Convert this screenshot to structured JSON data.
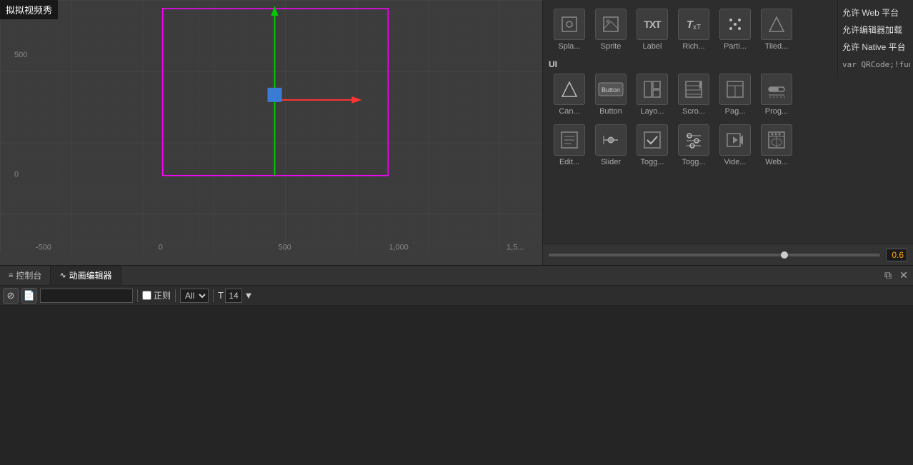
{
  "watermark": {
    "text": "拟拟视频秀"
  },
  "right_panel": {
    "ui_label": "UI",
    "components_row1": [
      {
        "id": "canvas",
        "label": "Can...",
        "icon": "△"
      },
      {
        "id": "button",
        "label": "Button",
        "icon": "▭"
      },
      {
        "id": "layout",
        "label": "Layo...",
        "icon": "⊞"
      },
      {
        "id": "scroll",
        "label": "Scro...",
        "icon": "▤"
      },
      {
        "id": "page",
        "label": "Pag...",
        "icon": "📄"
      },
      {
        "id": "progress",
        "label": "Prog...",
        "icon": "▬"
      }
    ],
    "components_row2": [
      {
        "id": "editbox",
        "label": "Edit...",
        "icon": "▭"
      },
      {
        "id": "slider",
        "label": "Slider",
        "icon": "⊕"
      },
      {
        "id": "toggle1",
        "label": "Togg...",
        "icon": "☑"
      },
      {
        "id": "toggle2",
        "label": "Togg...",
        "icon": "☰"
      },
      {
        "id": "video",
        "label": "Vide...",
        "icon": "▷"
      },
      {
        "id": "web",
        "label": "Web...",
        "icon": "🌐"
      }
    ],
    "top_row": [
      {
        "id": "splash",
        "label": "Spla...",
        "icon": "⊡"
      },
      {
        "id": "sprite",
        "label": "Sprite",
        "icon": "⊡"
      },
      {
        "id": "label",
        "label": "Label",
        "icon": "TXT"
      },
      {
        "id": "richtext",
        "label": "Rich...",
        "icon": "TxT"
      },
      {
        "id": "particle",
        "label": "Parti...",
        "icon": "⁘"
      },
      {
        "id": "tiled",
        "label": "Tiled...",
        "icon": "◇"
      }
    ],
    "slider_value": "0.6",
    "right_text": [
      {
        "text": "允许 Web 平台"
      },
      {
        "text": "允许编辑器加载"
      },
      {
        "text": "允许 Native 平台"
      }
    ],
    "code_text": "var QRCode;!fun"
  },
  "bottom_panel": {
    "tabs": [
      {
        "id": "console",
        "label": "控制台",
        "icon": "≡",
        "active": false
      },
      {
        "id": "animation",
        "label": "动画编辑器",
        "icon": "~",
        "active": true
      }
    ],
    "toolbar": {
      "stop_label": "⊘",
      "file_label": "📄",
      "search_placeholder": "",
      "regex_label": "正则",
      "all_label": "All",
      "font_icon": "T",
      "font_size": "14"
    }
  },
  "viewport": {
    "axis_x_label": "0",
    "axis_neg500": "-500",
    "axis_500": "500",
    "axis_1000": "1,000",
    "axis_1500": "1,5...",
    "axis_y_500": "500",
    "axis_y_0": "0"
  }
}
